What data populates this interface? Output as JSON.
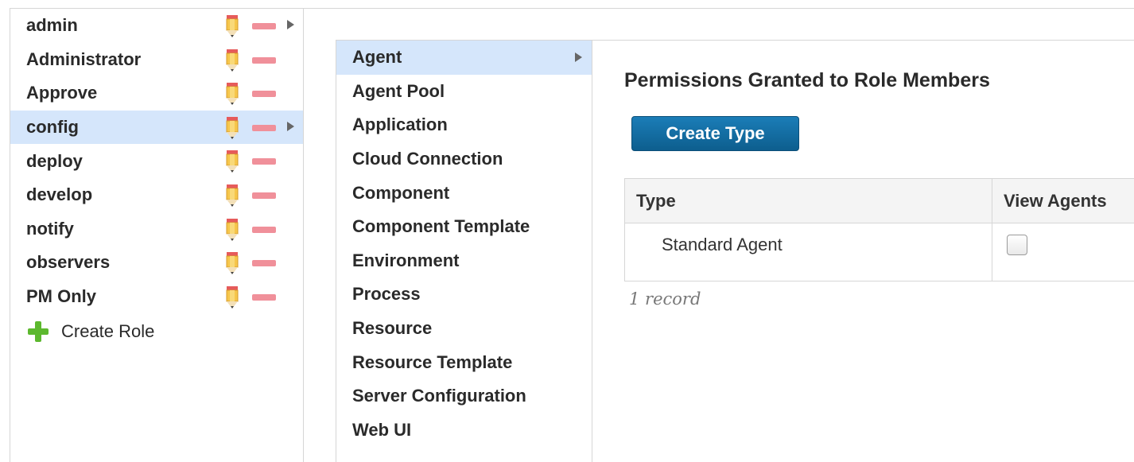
{
  "roles": {
    "items": [
      {
        "name": "admin",
        "has_arrow": true,
        "selected": false
      },
      {
        "name": "Administrator",
        "has_arrow": false,
        "selected": false
      },
      {
        "name": "Approve",
        "has_arrow": false,
        "selected": false
      },
      {
        "name": "config",
        "has_arrow": true,
        "selected": true
      },
      {
        "name": "deploy",
        "has_arrow": false,
        "selected": false
      },
      {
        "name": "develop",
        "has_arrow": false,
        "selected": false
      },
      {
        "name": "notify",
        "has_arrow": false,
        "selected": false
      },
      {
        "name": "observers",
        "has_arrow": false,
        "selected": false
      },
      {
        "name": "PM Only",
        "has_arrow": false,
        "selected": false
      }
    ],
    "create_label": "Create Role",
    "icons": [
      "pencil-icon",
      "minus-icon",
      "expand-arrow-icon",
      "plus-icon"
    ]
  },
  "types": {
    "items": [
      {
        "name": "Agent",
        "selected": true
      },
      {
        "name": "Agent Pool",
        "selected": false
      },
      {
        "name": "Application",
        "selected": false
      },
      {
        "name": "Cloud Connection",
        "selected": false
      },
      {
        "name": "Component",
        "selected": false
      },
      {
        "name": "Component Template",
        "selected": false
      },
      {
        "name": "Environment",
        "selected": false
      },
      {
        "name": "Process",
        "selected": false
      },
      {
        "name": "Resource",
        "selected": false
      },
      {
        "name": "Resource Template",
        "selected": false
      },
      {
        "name": "Server Configuration",
        "selected": false
      },
      {
        "name": "Web UI",
        "selected": false
      }
    ]
  },
  "content": {
    "title": "Permissions Granted to Role Members",
    "create_button": "Create Type",
    "table": {
      "columns": [
        "Type",
        "View Agents"
      ],
      "rows": [
        {
          "type": "Standard Agent",
          "view_agents": false
        }
      ]
    },
    "record_count": "1 record"
  },
  "colors": {
    "selected_row": "#d5e6fb",
    "button": "#0d5e8e",
    "minus": "#f0909a",
    "plus": "#5cb82e"
  }
}
